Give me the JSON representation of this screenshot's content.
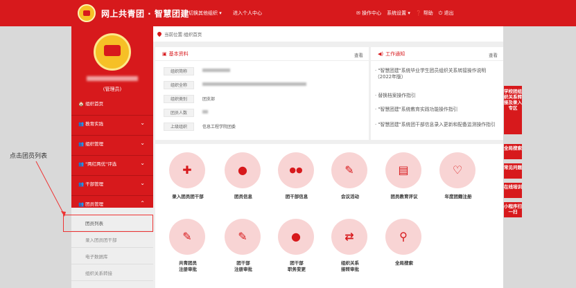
{
  "header": {
    "site_title": "网上共青团 · 智慧团建",
    "switch_org": "切换其他组织 ▾",
    "enter_center": "进入个人中心",
    "ops_center": "✉ 操作中心",
    "system_settings": "系统设置 ▾",
    "help": "❓ 帮助",
    "logout": "⏻ 退出"
  },
  "sidebar": {
    "role": "(管理员)",
    "items": [
      {
        "label": "🏠 组织首页"
      },
      {
        "label": "👥 教育实践",
        "chevron": "⌄"
      },
      {
        "label": "👥 组织管理",
        "chevron": "⌄"
      },
      {
        "label": "👥 \"两红两优\"评选",
        "chevron": "⌄"
      },
      {
        "label": "👥 干部管理",
        "chevron": "⌄"
      },
      {
        "label": "👥 团员管理",
        "chevron": "⌃"
      }
    ],
    "sub_items": [
      {
        "label": "团员列表"
      },
      {
        "label": "录入团员团干部"
      },
      {
        "label": "电子数据库"
      },
      {
        "label": "组织关系转接"
      }
    ]
  },
  "annotation": {
    "note": "点击团员列表"
  },
  "breadcrumb": "当前位置:组织首页",
  "basic_info": {
    "title": "基本资料",
    "more": "查看",
    "rows": [
      {
        "label": "组织简称",
        "value": ""
      },
      {
        "label": "组织全称",
        "value": ""
      },
      {
        "label": "组织类别",
        "value": "团支部"
      },
      {
        "label": "团员人数",
        "value": ""
      },
      {
        "label": "上级组织",
        "value": "信息工程学院团委"
      }
    ]
  },
  "notices": {
    "title": "工作通知",
    "more": "查看",
    "items": [
      "· \"智慧团建\"系统毕业学生团员组织关系转接操作说明（2022年版）",
      "· 替换档案操作指引",
      "· \"智慧团建\"系统教育实践功能操作指引",
      "· \"智慧团建\"系统团干部信息录入更新和配备监测操作指引"
    ]
  },
  "quick_tiles": [
    {
      "label": "录入团员团干部",
      "icon": "plus-square-icon",
      "glyph": "✚"
    },
    {
      "label": "团员信息",
      "icon": "user-icon",
      "glyph": "●"
    },
    {
      "label": "团干部信息",
      "icon": "users-icon",
      "glyph": "●●"
    },
    {
      "label": "会议活动",
      "icon": "edit-icon",
      "glyph": "✎"
    },
    {
      "label": "团员教育评议",
      "icon": "document-icon",
      "glyph": "▤"
    },
    {
      "label": "年度团籍注册",
      "icon": "heart-icon",
      "glyph": "♡"
    },
    {
      "label": "共青团员\n注册审批",
      "icon": "edit-square-icon",
      "glyph": "✎"
    },
    {
      "label": "团干部\n注册审批",
      "icon": "edit-square-icon",
      "glyph": "✎"
    },
    {
      "label": "团干部\n职务变更",
      "icon": "user-icon",
      "glyph": "●"
    },
    {
      "label": "组织关系\n接转审批",
      "icon": "transfer-icon",
      "glyph": "⇄"
    },
    {
      "label": "全局搜索",
      "icon": "search-icon",
      "glyph": "⚲"
    }
  ],
  "float_menu": [
    {
      "label": "学校团组织关系转接及录入专区"
    },
    {
      "label": "全局搜索"
    },
    {
      "label": "常见问题"
    },
    {
      "label": "在线培训"
    },
    {
      "label": "小程序扫一扫"
    }
  ],
  "colors": {
    "brand_red": "#d7191c",
    "icon_bg": "#f8d4d4"
  }
}
